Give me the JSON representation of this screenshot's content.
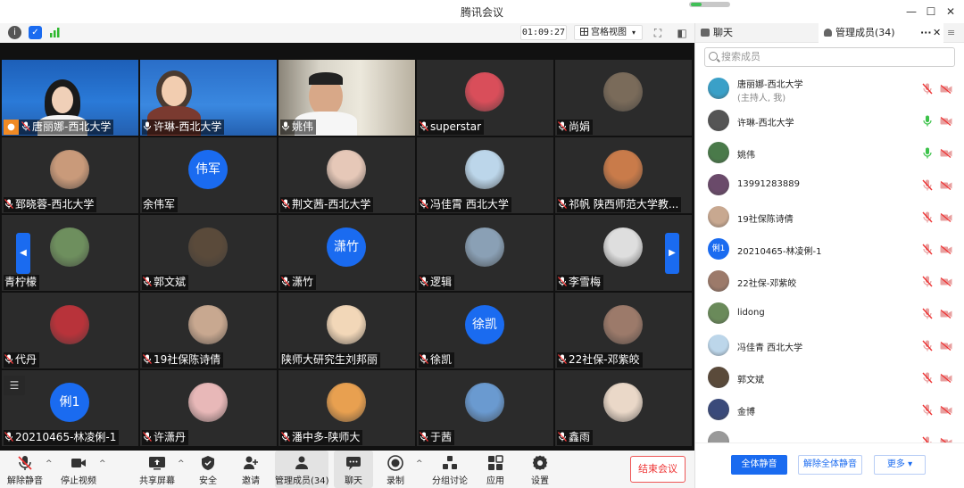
{
  "window": {
    "title": "腾讯会议"
  },
  "topbar": {
    "timer": "01:09:27",
    "grid_view_label": "宫格视图"
  },
  "tiles": [
    {
      "name": "唐丽娜-西北大学",
      "mic": "muted",
      "kind": "video",
      "host_badge": true
    },
    {
      "name": "许琳-西北大学",
      "mic": "on",
      "kind": "video"
    },
    {
      "name": "姚伟",
      "mic": "on",
      "kind": "video"
    },
    {
      "name": "superstar",
      "mic": "muted",
      "kind": "avatar",
      "avatar_color": "#d94e5a"
    },
    {
      "name": "尚娟",
      "mic": "muted",
      "kind": "avatar",
      "avatar_color": "#7a6b5a"
    },
    {
      "name": "郅晓蓉-西北大学",
      "mic": "muted",
      "kind": "avatar",
      "avatar_color": "#c99a7a"
    },
    {
      "name": "余伟军",
      "mic": "none",
      "kind": "initials",
      "initials": "伟军"
    },
    {
      "name": "荆文茜-西北大学",
      "mic": "muted",
      "kind": "avatar",
      "avatar_color": "#e6c8b8"
    },
    {
      "name": "冯佳霄 西北大学",
      "mic": "muted",
      "kind": "avatar",
      "avatar_color": "#bcd6ea"
    },
    {
      "name": "祁帆 陕西师范大学教...",
      "mic": "muted",
      "kind": "avatar",
      "avatar_color": "#c97b4a"
    },
    {
      "name": "青柠檬",
      "mic": "none",
      "kind": "avatar",
      "avatar_color": "#6e8f5e"
    },
    {
      "name": "郭文斌",
      "mic": "muted",
      "kind": "avatar",
      "avatar_color": "#5a4a3a"
    },
    {
      "name": "潇竹",
      "mic": "muted",
      "kind": "initials",
      "initials": "潇竹"
    },
    {
      "name": "逻辑",
      "mic": "muted",
      "kind": "avatar",
      "avatar_color": "#8aa0b5"
    },
    {
      "name": "李雪梅",
      "mic": "muted",
      "kind": "avatar",
      "avatar_color": "#dedede"
    },
    {
      "name": "代丹",
      "mic": "muted",
      "kind": "avatar",
      "avatar_color": "#b8333a"
    },
    {
      "name": "19社保陈诗倩",
      "mic": "muted",
      "kind": "avatar",
      "avatar_color": "#c8a890"
    },
    {
      "name": "陕师大研究生刘邦丽",
      "mic": "none",
      "kind": "avatar",
      "avatar_color": "#f2d7b8"
    },
    {
      "name": "徐凯",
      "mic": "muted",
      "kind": "initials",
      "initials": "徐凯"
    },
    {
      "name": "22社保-邓紫皎",
      "mic": "muted",
      "kind": "avatar",
      "avatar_color": "#9c7a6a"
    },
    {
      "name": "20210465-林凌俐-1",
      "mic": "muted",
      "kind": "initials",
      "initials": "俐1"
    },
    {
      "name": "许潇丹",
      "mic": "muted",
      "kind": "avatar",
      "avatar_color": "#e8b8b8"
    },
    {
      "name": "潘中多-陕师大",
      "mic": "muted",
      "kind": "avatar",
      "avatar_color": "#e8a050"
    },
    {
      "name": "于茜",
      "mic": "muted",
      "kind": "avatar",
      "avatar_color": "#6a9ad0"
    },
    {
      "name": "鑫雨",
      "mic": "muted",
      "kind": "avatar",
      "avatar_color": "#ead8c8"
    }
  ],
  "toolbar": {
    "unmute": "解除静音",
    "stop_video": "停止视频",
    "share_screen": "共享屏幕",
    "security": "安全",
    "invite": "邀请",
    "manage_members": "管理成员(34)",
    "chat": "聊天",
    "record": "录制",
    "breakout": "分组讨论",
    "apps": "应用",
    "settings": "设置",
    "end_meeting": "结束会议"
  },
  "panel": {
    "tab_chat": "聊天",
    "tab_members": "管理成员(34)",
    "search_placeholder": "搜索成员",
    "members": [
      {
        "name": "唐丽娜-西北大学",
        "sub": "(主持人, 我)",
        "mic": "muted",
        "avatar_color": "#3aa0c8"
      },
      {
        "name": "许琳-西北大学",
        "mic": "on",
        "avatar_color": "#555555"
      },
      {
        "name": "姚伟",
        "mic": "on",
        "avatar_color": "#4a7a4a"
      },
      {
        "name": "13991283889",
        "mic": "muted",
        "avatar_color": "#6a4a6a"
      },
      {
        "name": "19社保陈诗倩",
        "mic": "muted",
        "avatar_color": "#c8a890"
      },
      {
        "name": "20210465-林凌俐-1",
        "mic": "muted",
        "initials": "俐1"
      },
      {
        "name": "22社保-邓紫皎",
        "mic": "muted",
        "avatar_color": "#9c7a6a"
      },
      {
        "name": "lidong",
        "mic": "muted",
        "avatar_color": "#6a8a5a"
      },
      {
        "name": "冯佳青 西北大学",
        "mic": "muted",
        "avatar_color": "#bcd6ea"
      },
      {
        "name": "郭文斌",
        "mic": "muted",
        "avatar_color": "#5a4a3a"
      },
      {
        "name": "金博",
        "mic": "muted",
        "avatar_color": "#3a4a7a"
      },
      {
        "name": "",
        "mic": "muted",
        "avatar_color": "#999999"
      }
    ],
    "mute_all": "全体静音",
    "unmute_all": "解除全体静音",
    "more": "更多"
  }
}
